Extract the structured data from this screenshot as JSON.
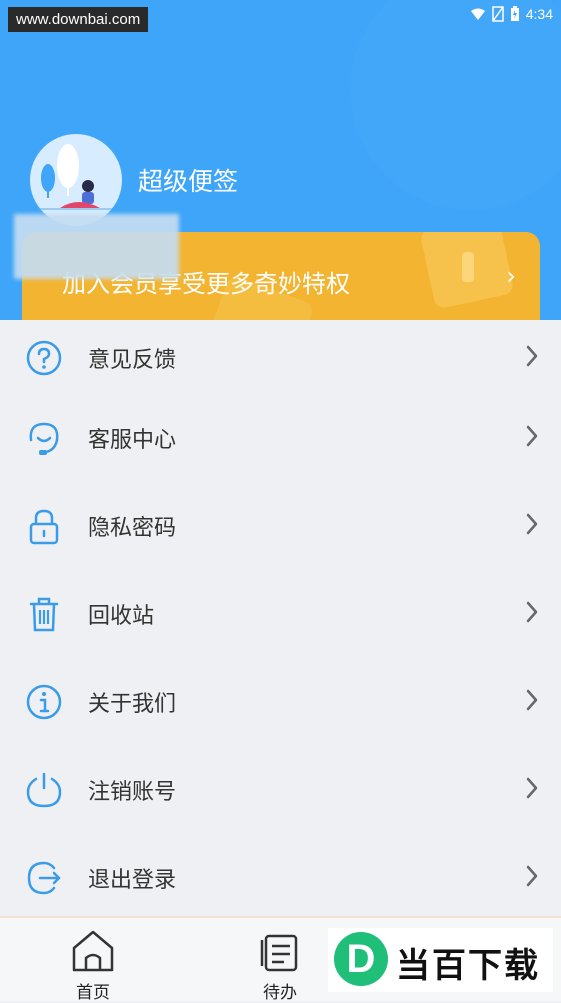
{
  "watermark_url": "www.downbai.com",
  "status": {
    "time": "4:34"
  },
  "header": {
    "app_title": "超级便签"
  },
  "vip": {
    "text": "加入会员享受更多奇妙特权",
    "arrow": "›"
  },
  "menu": [
    {
      "label": "意见反馈",
      "icon": "question-circle-icon"
    },
    {
      "label": "客服中心",
      "icon": "headset-icon"
    },
    {
      "label": "隐私密码",
      "icon": "lock-icon"
    },
    {
      "label": "回收站",
      "icon": "trash-icon"
    },
    {
      "label": "关于我们",
      "icon": "info-circle-icon"
    },
    {
      "label": "注销账号",
      "icon": "power-icon"
    },
    {
      "label": "退出登录",
      "icon": "logout-icon"
    }
  ],
  "tabs": [
    {
      "label": "首页",
      "icon": "home-icon"
    },
    {
      "label": "待办",
      "icon": "todo-icon"
    }
  ],
  "brand": {
    "letter": "D",
    "text": "当百下载"
  },
  "colors": {
    "header": "#3fa5f9",
    "vip": "#f3b431",
    "icon": "#3a9be8",
    "background": "#eef0f3"
  }
}
